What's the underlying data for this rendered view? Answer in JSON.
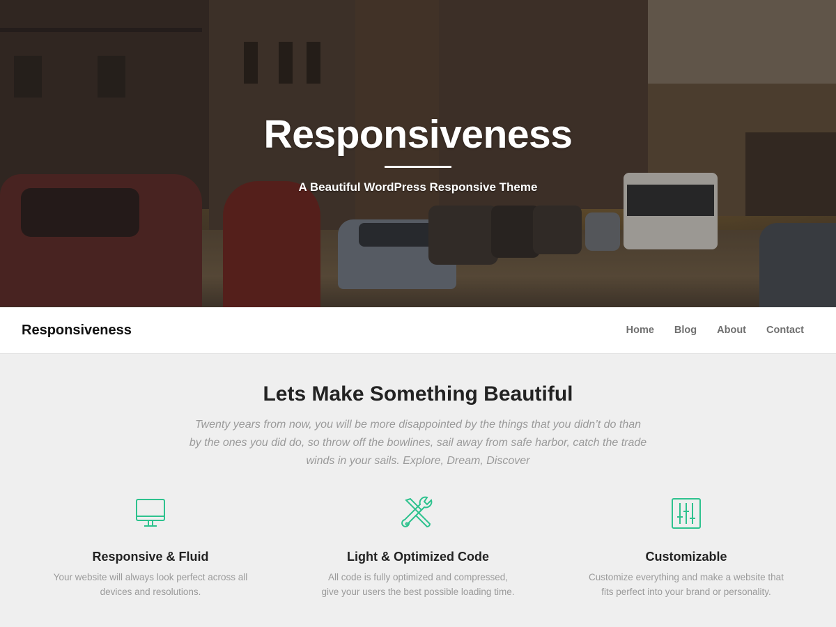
{
  "hero": {
    "title": "Responsiveness",
    "tagline": "A Beautiful WordPress Responsive Theme"
  },
  "nav": {
    "brand": "Responsiveness",
    "items": [
      {
        "label": "Home"
      },
      {
        "label": "Blog"
      },
      {
        "label": "About"
      },
      {
        "label": "Contact"
      }
    ]
  },
  "intro": {
    "title": "Lets Make Something Beautiful",
    "quote": "Twenty years from now, you will be more disappointed by the things that you didn’t do than by the ones you did do, so throw off the bowlines, sail away from safe harbor, catch the trade winds in your sails. Explore, Dream, Discover"
  },
  "features": [
    {
      "icon": "monitor-icon",
      "title": "Responsive & Fluid",
      "text": "Your website will always look perfect across all devices and resolutions."
    },
    {
      "icon": "tools-icon",
      "title": "Light & Optimized Code",
      "text": "All code is fully optimized and compressed, give your users the best possible loading time."
    },
    {
      "icon": "sliders-icon",
      "title": "Customizable",
      "text": "Customize everything and make a website that fits perfect into your brand or personality."
    }
  ],
  "colors": {
    "accent": "#2ec28e",
    "background": "#efefef",
    "navbar": "#ffffff"
  }
}
